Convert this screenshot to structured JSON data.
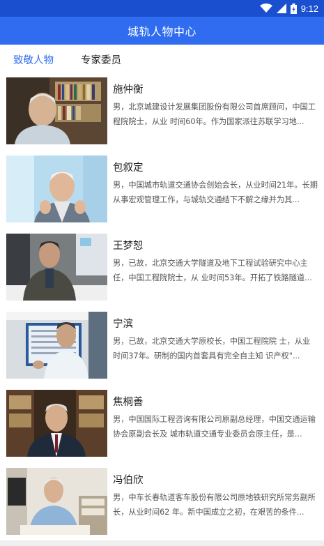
{
  "status_bar": {
    "time": "9:12",
    "icons": [
      "wifi-icon",
      "cell-signal-icon",
      "battery-icon"
    ]
  },
  "app_bar": {
    "title": "城轨人物中心"
  },
  "tabs": [
    {
      "label": "致敬人物",
      "active": true
    },
    {
      "label": "专家委员",
      "active": false
    }
  ],
  "colors": {
    "status_bar": "#1a4fcf",
    "app_bar": "#2f6cf0",
    "tab_active": "#2f6cf0",
    "tab_inactive": "#222222",
    "description_text": "#555555"
  },
  "people": [
    {
      "name": "施仲衡",
      "description": "男，北京城建设计发展集团股份有限公司首席顾问，中国工程院院士，从业 时间60年。作为国家派往苏联学习地..."
    },
    {
      "name": "包叙定",
      "description": "男，中国城市轨道交通协会创始会长，从业时间21年。长期从事宏观管理工作，与城轨交通结下不解之缘并为其..."
    },
    {
      "name": "王梦恕",
      "description": "男，已故，北京交通大学隧道及地下工程试验研究中心主任，中国工程院院士，从 业时间53年。开拓了铁路隧道..."
    },
    {
      "name": "宁滨",
      "description": "男，已故，北京交通大学原校长，中国工程院院 士，从业时间37年。研制的国内首套具有完全自主知 识产权\"..."
    },
    {
      "name": "焦桐善",
      "description": "男，中国国际工程咨询有限公司原副总经理，中国交通运输协会原副会长及 城市轨道交通专业委员会原主任，是..."
    },
    {
      "name": "冯伯欣",
      "description": "男，中车长春轨道客车股份有限公司原地铁研究所常务副所长，从业时间62 年。新中国成立之初，在艰苦的条件..."
    }
  ]
}
